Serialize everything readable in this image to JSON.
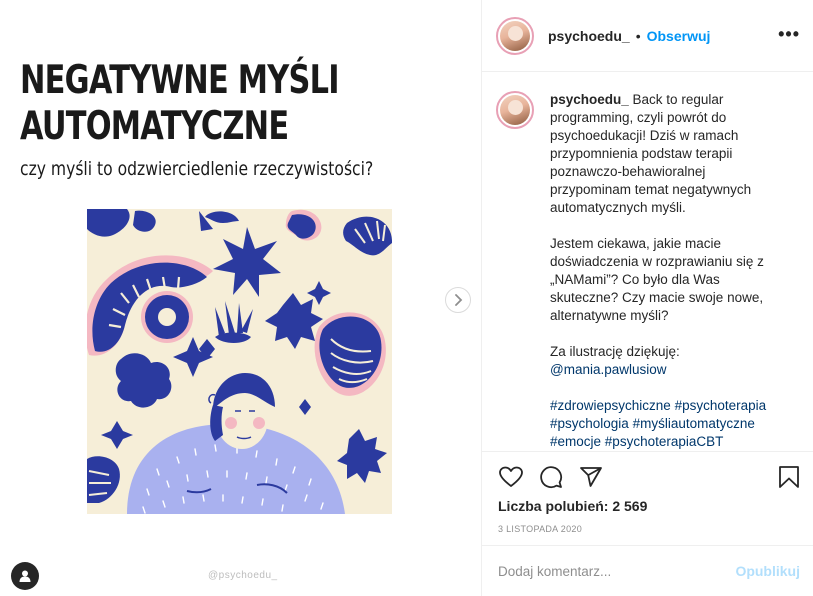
{
  "media": {
    "title_line1": "NEGATYWNE MYŚLI",
    "title_line2": "AUTOMATYCZNE",
    "subtitle": "czy myśli to odzwierciedlenie rzeczywistości?",
    "watermark": "@psychoedu_",
    "icons": {
      "next": "chevron-right-icon",
      "user_tag": "user-icon"
    },
    "colors": {
      "ink": "#2b3a9f",
      "pink": "#f4b8c2",
      "lavender": "#a9b1ef",
      "cream": "#f6eed8"
    }
  },
  "header": {
    "username": "psychoedu_",
    "separator": "•",
    "follow_label": "Obserwuj",
    "more_label": "•••"
  },
  "caption": {
    "username": "psychoedu_",
    "paragraph1": "Back to regular programming, czyli powrót do psychoedukacji! Dziś w ramach przypomnienia podstaw terapii poznawczo-behawioralnej przypominam temat negatywnych automatycznych myśli.",
    "paragraph2": "Jestem ciekawa, jakie macie doświadczenia w rozprawianiu się z „NAMami”? Co było dla Was skuteczne? Czy macie swoje nowe, alternatywne myśli?",
    "credit_text": "Za ilustrację dziękuję:",
    "credit_mention": "@mania.pawlusiow",
    "hashtags": [
      "#zdrowiepsychiczne",
      "#psychoterapia",
      "#psychologia",
      "#myśliautomatyczne",
      "#emocje",
      "#psychoterapiaCBT"
    ]
  },
  "actions": {
    "icons": [
      "heart-icon",
      "comment-icon",
      "share-icon",
      "bookmark-icon"
    ],
    "likes": "Liczba polubień: 2 569",
    "date": "3 LISTOPADA 2020"
  },
  "comment_box": {
    "placeholder": "Dodaj komentarz...",
    "publish_label": "Opublikuj"
  }
}
